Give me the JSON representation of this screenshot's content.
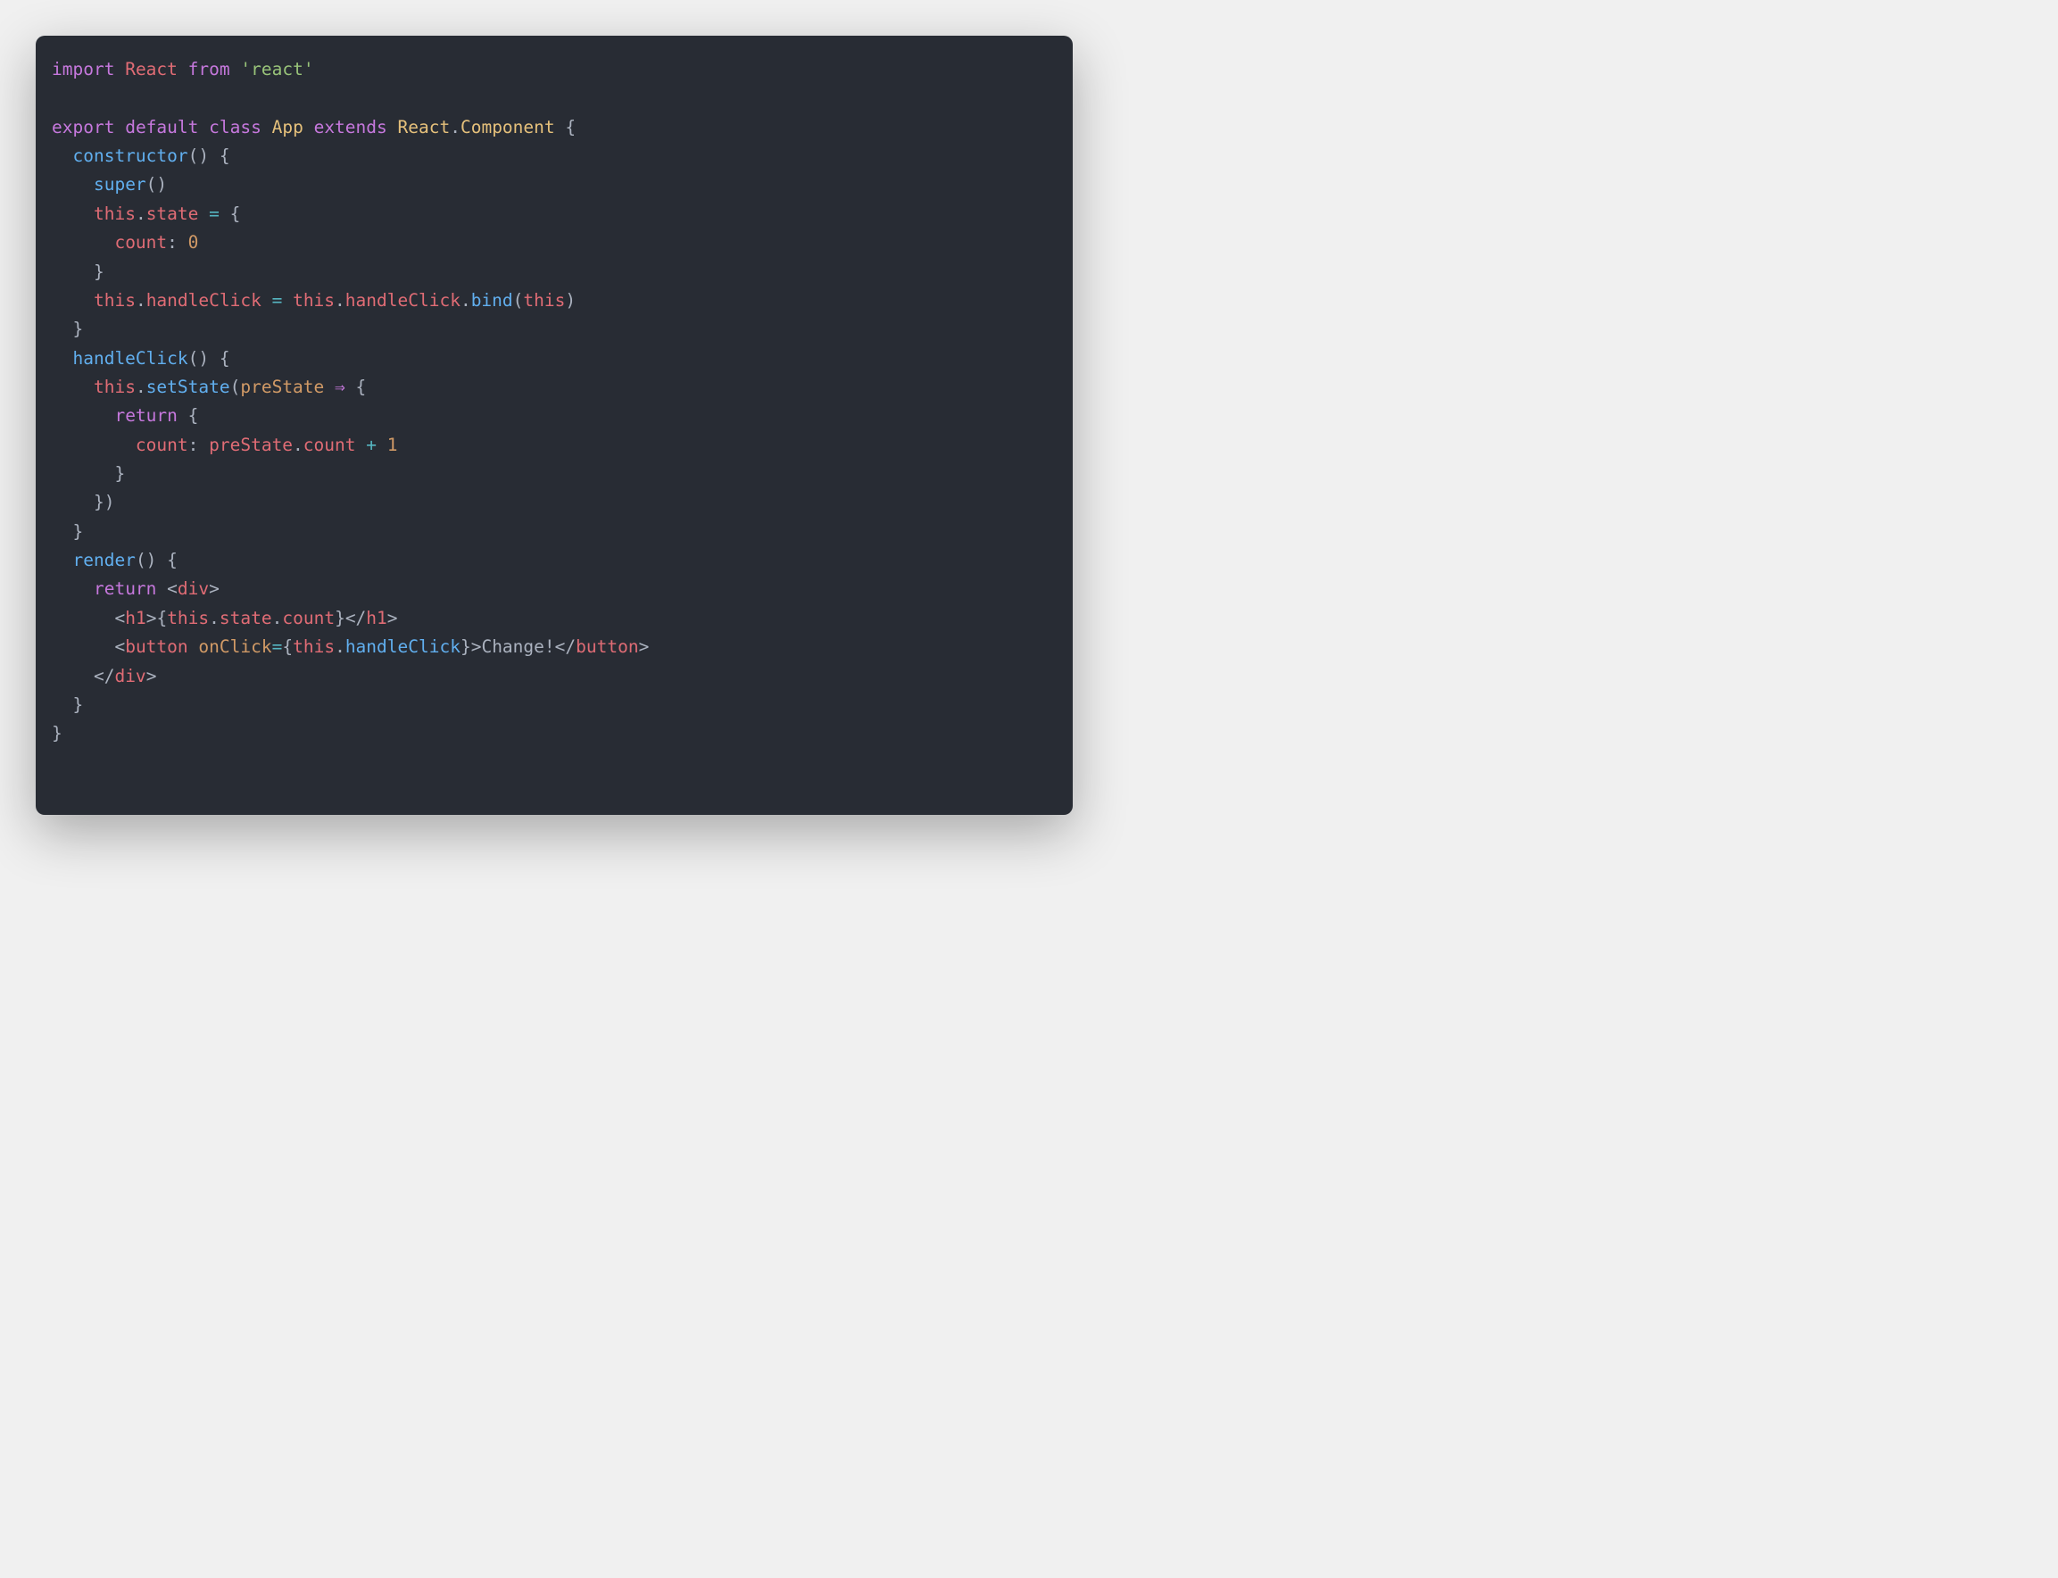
{
  "colors": {
    "bg": "#282c34",
    "default": "#abb2bf",
    "keyword": "#c678dd",
    "variable": "#e06c75",
    "string": "#98c379",
    "classname": "#e5c07b",
    "function": "#61afef",
    "property": "#e06c75",
    "number": "#d19a66",
    "param": "#d19a66",
    "operator": "#56b6c2",
    "punct": "#abb2bf",
    "tag": "#e06c75",
    "attr": "#d19a66"
  },
  "code": [
    [
      {
        "c": "keyword",
        "t": "import"
      },
      {
        "c": "default",
        "t": " "
      },
      {
        "c": "variable",
        "t": "React"
      },
      {
        "c": "default",
        "t": " "
      },
      {
        "c": "keyword",
        "t": "from"
      },
      {
        "c": "default",
        "t": " "
      },
      {
        "c": "string",
        "t": "'react'"
      }
    ],
    [],
    [
      {
        "c": "keyword",
        "t": "export"
      },
      {
        "c": "default",
        "t": " "
      },
      {
        "c": "keyword",
        "t": "default"
      },
      {
        "c": "default",
        "t": " "
      },
      {
        "c": "keyword",
        "t": "class"
      },
      {
        "c": "default",
        "t": " "
      },
      {
        "c": "classname",
        "t": "App"
      },
      {
        "c": "default",
        "t": " "
      },
      {
        "c": "keyword",
        "t": "extends"
      },
      {
        "c": "default",
        "t": " "
      },
      {
        "c": "classname",
        "t": "React"
      },
      {
        "c": "punct",
        "t": "."
      },
      {
        "c": "classname",
        "t": "Component"
      },
      {
        "c": "default",
        "t": " "
      },
      {
        "c": "punct",
        "t": "{"
      }
    ],
    [
      {
        "c": "default",
        "t": "  "
      },
      {
        "c": "function",
        "t": "constructor"
      },
      {
        "c": "punct",
        "t": "()"
      },
      {
        "c": "default",
        "t": " "
      },
      {
        "c": "punct",
        "t": "{"
      }
    ],
    [
      {
        "c": "default",
        "t": "    "
      },
      {
        "c": "function",
        "t": "super"
      },
      {
        "c": "punct",
        "t": "()"
      }
    ],
    [
      {
        "c": "default",
        "t": "    "
      },
      {
        "c": "variable",
        "t": "this"
      },
      {
        "c": "punct",
        "t": "."
      },
      {
        "c": "property",
        "t": "state"
      },
      {
        "c": "default",
        "t": " "
      },
      {
        "c": "operator",
        "t": "="
      },
      {
        "c": "default",
        "t": " "
      },
      {
        "c": "punct",
        "t": "{"
      }
    ],
    [
      {
        "c": "default",
        "t": "      "
      },
      {
        "c": "property",
        "t": "count"
      },
      {
        "c": "punct",
        "t": ":"
      },
      {
        "c": "default",
        "t": " "
      },
      {
        "c": "number",
        "t": "0"
      }
    ],
    [
      {
        "c": "default",
        "t": "    "
      },
      {
        "c": "punct",
        "t": "}"
      }
    ],
    [
      {
        "c": "default",
        "t": "    "
      },
      {
        "c": "variable",
        "t": "this"
      },
      {
        "c": "punct",
        "t": "."
      },
      {
        "c": "property",
        "t": "handleClick"
      },
      {
        "c": "default",
        "t": " "
      },
      {
        "c": "operator",
        "t": "="
      },
      {
        "c": "default",
        "t": " "
      },
      {
        "c": "variable",
        "t": "this"
      },
      {
        "c": "punct",
        "t": "."
      },
      {
        "c": "property",
        "t": "handleClick"
      },
      {
        "c": "punct",
        "t": "."
      },
      {
        "c": "function",
        "t": "bind"
      },
      {
        "c": "punct",
        "t": "("
      },
      {
        "c": "variable",
        "t": "this"
      },
      {
        "c": "punct",
        "t": ")"
      }
    ],
    [
      {
        "c": "default",
        "t": "  "
      },
      {
        "c": "punct",
        "t": "}"
      }
    ],
    [
      {
        "c": "default",
        "t": "  "
      },
      {
        "c": "function",
        "t": "handleClick"
      },
      {
        "c": "punct",
        "t": "()"
      },
      {
        "c": "default",
        "t": " "
      },
      {
        "c": "punct",
        "t": "{"
      }
    ],
    [
      {
        "c": "default",
        "t": "    "
      },
      {
        "c": "variable",
        "t": "this"
      },
      {
        "c": "punct",
        "t": "."
      },
      {
        "c": "function",
        "t": "setState"
      },
      {
        "c": "punct",
        "t": "("
      },
      {
        "c": "param",
        "t": "preState"
      },
      {
        "c": "default",
        "t": " "
      },
      {
        "c": "keyword",
        "t": "⇒"
      },
      {
        "c": "default",
        "t": " "
      },
      {
        "c": "punct",
        "t": "{"
      }
    ],
    [
      {
        "c": "default",
        "t": "      "
      },
      {
        "c": "keyword",
        "t": "return"
      },
      {
        "c": "default",
        "t": " "
      },
      {
        "c": "punct",
        "t": "{"
      }
    ],
    [
      {
        "c": "default",
        "t": "        "
      },
      {
        "c": "property",
        "t": "count"
      },
      {
        "c": "punct",
        "t": ":"
      },
      {
        "c": "default",
        "t": " "
      },
      {
        "c": "variable",
        "t": "preState"
      },
      {
        "c": "punct",
        "t": "."
      },
      {
        "c": "property",
        "t": "count"
      },
      {
        "c": "default",
        "t": " "
      },
      {
        "c": "operator",
        "t": "+"
      },
      {
        "c": "default",
        "t": " "
      },
      {
        "c": "number",
        "t": "1"
      }
    ],
    [
      {
        "c": "default",
        "t": "      "
      },
      {
        "c": "punct",
        "t": "}"
      }
    ],
    [
      {
        "c": "default",
        "t": "    "
      },
      {
        "c": "punct",
        "t": "})"
      }
    ],
    [
      {
        "c": "default",
        "t": "  "
      },
      {
        "c": "punct",
        "t": "}"
      }
    ],
    [
      {
        "c": "default",
        "t": "  "
      },
      {
        "c": "function",
        "t": "render"
      },
      {
        "c": "punct",
        "t": "()"
      },
      {
        "c": "default",
        "t": " "
      },
      {
        "c": "punct",
        "t": "{"
      }
    ],
    [
      {
        "c": "default",
        "t": "    "
      },
      {
        "c": "keyword",
        "t": "return"
      },
      {
        "c": "default",
        "t": " "
      },
      {
        "c": "punct",
        "t": "<"
      },
      {
        "c": "tag",
        "t": "div"
      },
      {
        "c": "punct",
        "t": ">"
      }
    ],
    [
      {
        "c": "default",
        "t": "      "
      },
      {
        "c": "punct",
        "t": "<"
      },
      {
        "c": "tag",
        "t": "h1"
      },
      {
        "c": "punct",
        "t": ">"
      },
      {
        "c": "punct",
        "t": "{"
      },
      {
        "c": "variable",
        "t": "this"
      },
      {
        "c": "punct",
        "t": "."
      },
      {
        "c": "property",
        "t": "state"
      },
      {
        "c": "punct",
        "t": "."
      },
      {
        "c": "property",
        "t": "count"
      },
      {
        "c": "punct",
        "t": "}"
      },
      {
        "c": "punct",
        "t": "</"
      },
      {
        "c": "tag",
        "t": "h1"
      },
      {
        "c": "punct",
        "t": ">"
      }
    ],
    [
      {
        "c": "default",
        "t": "      "
      },
      {
        "c": "punct",
        "t": "<"
      },
      {
        "c": "tag",
        "t": "button"
      },
      {
        "c": "default",
        "t": " "
      },
      {
        "c": "attr",
        "t": "onClick"
      },
      {
        "c": "operator",
        "t": "="
      },
      {
        "c": "punct",
        "t": "{"
      },
      {
        "c": "variable",
        "t": "this"
      },
      {
        "c": "punct",
        "t": "."
      },
      {
        "c": "function",
        "t": "handleClick"
      },
      {
        "c": "punct",
        "t": "}"
      },
      {
        "c": "punct",
        "t": ">"
      },
      {
        "c": "default",
        "t": "Change!"
      },
      {
        "c": "punct",
        "t": "</"
      },
      {
        "c": "tag",
        "t": "button"
      },
      {
        "c": "punct",
        "t": ">"
      }
    ],
    [
      {
        "c": "default",
        "t": "    "
      },
      {
        "c": "punct",
        "t": "</"
      },
      {
        "c": "tag",
        "t": "div"
      },
      {
        "c": "punct",
        "t": ">"
      }
    ],
    [
      {
        "c": "default",
        "t": "  "
      },
      {
        "c": "punct",
        "t": "}"
      }
    ],
    [
      {
        "c": "punct",
        "t": "}"
      }
    ]
  ]
}
